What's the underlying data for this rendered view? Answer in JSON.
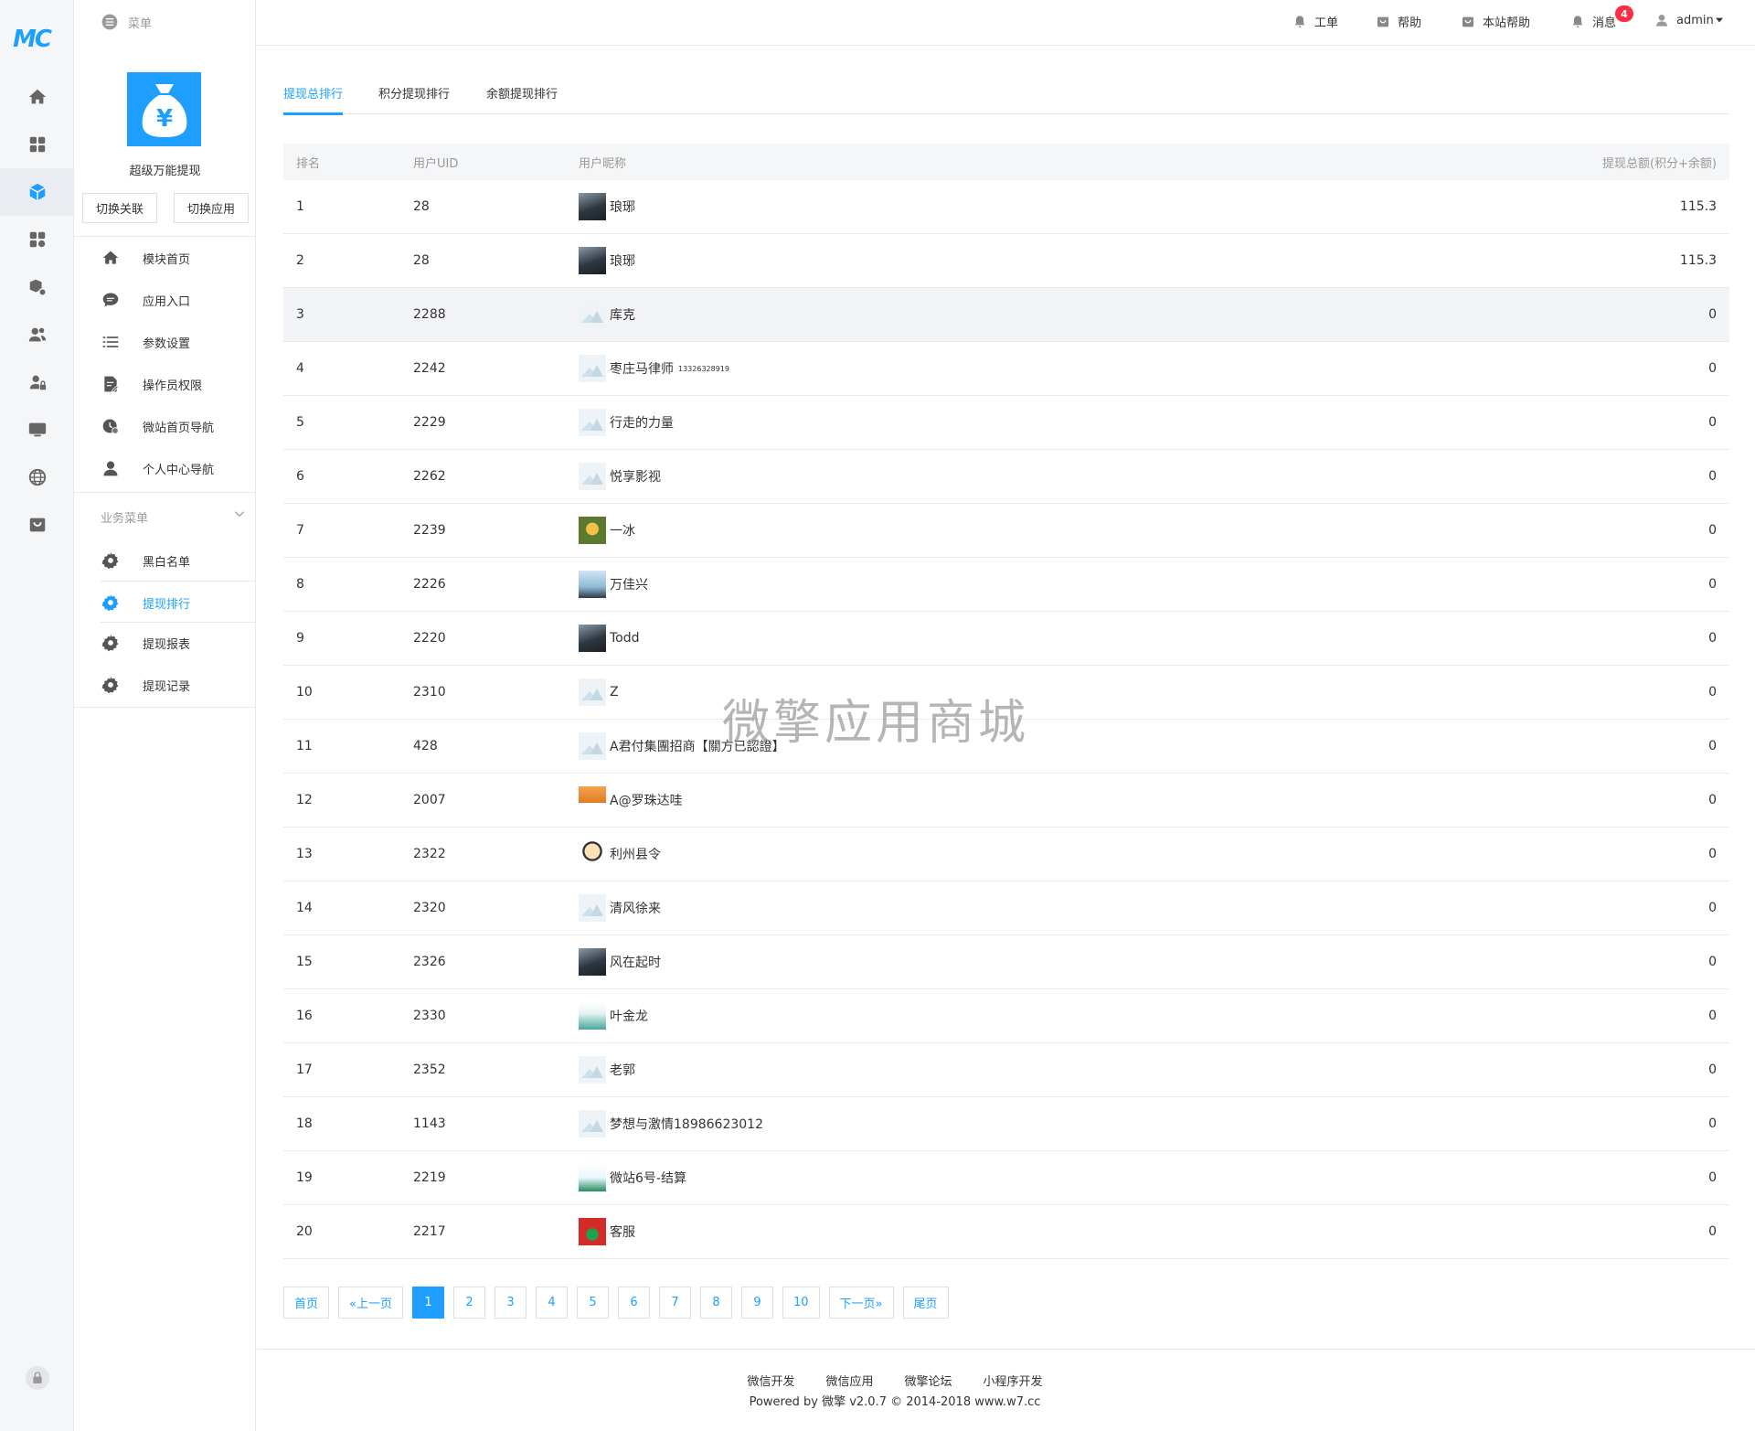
{
  "rail": {
    "logo": "MC"
  },
  "topbar": {
    "menu_label": "菜单",
    "items": [
      {
        "label": "工单",
        "icon": "bell-icon"
      },
      {
        "label": "帮助",
        "icon": "shop-bag-icon"
      },
      {
        "label": "本站帮助",
        "icon": "shop-bag-icon"
      },
      {
        "label": "消息",
        "icon": "bell-icon"
      },
      {
        "label": "admin",
        "icon": "user-icon"
      }
    ],
    "message_count": "4"
  },
  "app": {
    "name": "超级万能提现",
    "switch_relation": "切换关联",
    "switch_app": "切换应用"
  },
  "menu": [
    {
      "label": "模块首页",
      "icon": "home-icon"
    },
    {
      "label": "应用入口",
      "icon": "chat-icon"
    },
    {
      "label": "参数设置",
      "icon": "list-icon"
    },
    {
      "label": "操作员权限",
      "icon": "edit-doc-icon"
    },
    {
      "label": "微站首页导航",
      "icon": "clock-icon"
    },
    {
      "label": "个人中心导航",
      "icon": "user-icon"
    }
  ],
  "business_menu": {
    "title": "业务菜单",
    "items": [
      {
        "label": "黑白名单"
      },
      {
        "label": "提现排行"
      },
      {
        "label": "提现报表"
      },
      {
        "label": "提现记录"
      }
    ]
  },
  "tabs": [
    "提现总排行",
    "积分提现排行",
    "余额提现排行"
  ],
  "table": {
    "headers": [
      "排名",
      "用户UID",
      "用户昵称",
      "提现总额(积分+余额)"
    ],
    "rows": [
      {
        "rank": "1",
        "uid": "28",
        "nick": "琅琊",
        "amount": "115.3",
        "avatar": "photo-dark"
      },
      {
        "rank": "2",
        "uid": "28",
        "nick": "琅琊",
        "amount": "115.3",
        "avatar": "photo-dark"
      },
      {
        "rank": "3",
        "uid": "2288",
        "nick": "库克",
        "amount": "0",
        "avatar": "default"
      },
      {
        "rank": "4",
        "uid": "2242",
        "nick": "枣庄马律师",
        "nick_sup": "13326328919",
        "amount": "0",
        "avatar": "default"
      },
      {
        "rank": "5",
        "uid": "2229",
        "nick": "行走的力量",
        "amount": "0",
        "avatar": "default"
      },
      {
        "rank": "6",
        "uid": "2262",
        "nick": "悦享影视",
        "amount": "0",
        "avatar": "default"
      },
      {
        "rank": "7",
        "uid": "2239",
        "nick": "一冰",
        "amount": "0",
        "avatar": "photo-green"
      },
      {
        "rank": "8",
        "uid": "2226",
        "nick": "万佳兴",
        "amount": "0",
        "avatar": "photo-sky"
      },
      {
        "rank": "9",
        "uid": "2220",
        "nick": "Todd",
        "amount": "0",
        "avatar": "photo-dark"
      },
      {
        "rank": "10",
        "uid": "2310",
        "nick": "Z",
        "amount": "0",
        "avatar": "default"
      },
      {
        "rank": "11",
        "uid": "428",
        "nick": "A君付集團招商【關方已認證】",
        "amount": "0",
        "avatar": "default"
      },
      {
        "rank": "12",
        "uid": "2007",
        "nick": "A@罗珠达哇",
        "amount": "0",
        "avatar": "photo-orange"
      },
      {
        "rank": "13",
        "uid": "2322",
        "nick": "利州县令",
        "amount": "0",
        "avatar": "photo-cartoon"
      },
      {
        "rank": "14",
        "uid": "2320",
        "nick": "清风徐来",
        "amount": "0",
        "avatar": "default"
      },
      {
        "rank": "15",
        "uid": "2326",
        "nick": "风在起时",
        "amount": "0",
        "avatar": "photo-dark"
      },
      {
        "rank": "16",
        "uid": "2330",
        "nick": "叶金龙",
        "amount": "0",
        "avatar": "photo-teal"
      },
      {
        "rank": "17",
        "uid": "2352",
        "nick": "老郭",
        "amount": "0",
        "avatar": "default"
      },
      {
        "rank": "18",
        "uid": "1143",
        "nick": "梦想与激情18986623012",
        "amount": "0",
        "avatar": "default"
      },
      {
        "rank": "19",
        "uid": "2219",
        "nick": "微站6号-结算",
        "amount": "0",
        "avatar": "photo-logo"
      },
      {
        "rank": "20",
        "uid": "2217",
        "nick": "客服",
        "amount": "0",
        "avatar": "photo-red"
      }
    ]
  },
  "pagination": {
    "first": "首页",
    "prev": "«上一页",
    "pages": [
      "1",
      "2",
      "3",
      "4",
      "5",
      "6",
      "7",
      "8",
      "9",
      "10"
    ],
    "current": "1",
    "next": "下一页»",
    "last": "尾页"
  },
  "footer": {
    "links": [
      "微信开发",
      "微信应用",
      "微擎论坛",
      "小程序开发"
    ],
    "copyright": "Powered by 微擎 v2.0.7 © 2014-2018 www.w7.cc"
  },
  "watermark": "微擎应用商城",
  "colors": {
    "accent": "#1e9fff",
    "badge": "#ff2d43"
  }
}
